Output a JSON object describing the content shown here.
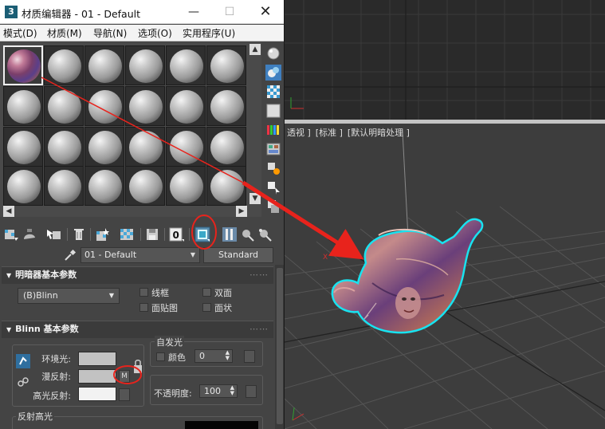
{
  "window": {
    "app_icon_text": "3",
    "title": "材质编辑器 - 01 - Default",
    "minimize_glyph": "—",
    "maximize_glyph": "☐",
    "close_glyph": "✕"
  },
  "menu": {
    "items": [
      {
        "label": "模式(D)"
      },
      {
        "label": "材质(M)"
      },
      {
        "label": "导航(N)"
      },
      {
        "label": "选项(O)"
      },
      {
        "label": "实用程序(U)"
      }
    ]
  },
  "slots": {
    "rows": 4,
    "cols": 6,
    "active_index": 0
  },
  "toolbar": {
    "show_map_index_label": "0"
  },
  "material": {
    "name": "01 - Default",
    "type": "Standard"
  },
  "shader_rollout": {
    "title": "明暗器基本参数",
    "shader": "(B)Blinn",
    "options": [
      {
        "label": "线框"
      },
      {
        "label": "双面"
      },
      {
        "label": "面贴图"
      },
      {
        "label": "面状"
      }
    ]
  },
  "blinn_rollout": {
    "title": "Blinn 基本参数",
    "ambient_label": "环境光:",
    "diffuse_label": "漫反射:",
    "specular_label": "高光反射:",
    "diffuse_map_button": "M",
    "self_illum": {
      "title": "自发光",
      "color_label": "颜色",
      "value": "0"
    },
    "opacity_label": "不透明度:",
    "opacity_value": "100",
    "spec_highlights_title": "反射高光"
  },
  "viewport": {
    "label_view": "透视 ]",
    "label_shading": "[标准 ]",
    "label_lighting": "[默认明暗处理 ]"
  },
  "colors": {
    "annotation_red": "#e8231c",
    "selection_cyan": "#18e3f0",
    "viewport_bg": "#3d3d3d",
    "panel_bg": "#444444"
  }
}
